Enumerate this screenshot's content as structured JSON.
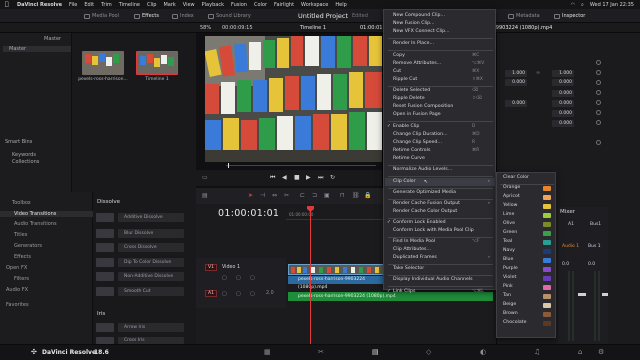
{
  "menubar": {
    "apple": "",
    "items": [
      "DaVinci Resolve",
      "File",
      "Edit",
      "Trim",
      "Timeline",
      "Clip",
      "Mark",
      "View",
      "Playback",
      "Fusion",
      "Color",
      "Fairlight",
      "Workspace",
      "Help"
    ],
    "datetime": "Wed 17 Jan  22:35"
  },
  "toolbar": {
    "media_pool": "Media Pool",
    "effects": "Effects",
    "index": "Index",
    "sound_library": "Sound Library",
    "project_title": "Untitled Project",
    "project_status": "Edited",
    "metadata": "Metadata",
    "inspector": "Inspector"
  },
  "viewer": {
    "zoom": "58%",
    "timecode": "00:00:09:15",
    "timeline_name": "Timeline 1",
    "timecode_right": "01:00:01"
  },
  "media_pool": {
    "bin_master": "Master",
    "header": "Master",
    "smart_bins": "Smart Bins",
    "smart_items": [
      "Keywords",
      "Collections"
    ],
    "clips": [
      {
        "name": "pexels-ross-harrison..."
      },
      {
        "name": "Timeline 1"
      }
    ]
  },
  "effects": {
    "toolbox": "Toolbox",
    "categories": [
      "Video Transitions",
      "Audio Transitions",
      "Titles",
      "Generators",
      "Effects"
    ],
    "open_fx": "Open FX",
    "filters": "Filters",
    "audio_fx": "Audio FX",
    "favorites": "Favorites",
    "section_dissolve": "Dissolve",
    "dissolves": [
      "Additive Dissolve",
      "Blur Dissolve",
      "Cross Dissolve",
      "Dip To Color Dissolve",
      "Non-Additive Dissolve",
      "Smooth Cut"
    ],
    "section_iris": "Iris",
    "iris": [
      "Arrow Iris",
      "Cross Iris"
    ]
  },
  "timeline": {
    "timecode": "01:00:01:01",
    "ruler_start": "01:00:00:00",
    "video_track_badge": "V1",
    "video_track_name": "Video 1",
    "audio_track_badge": "A1",
    "audio_value": "2.0",
    "video_clip_name": "pexels-ross-harrison-9903224 (1080p).mp4",
    "audio_clip_name": "pexels-ross-harrison-9903224 (1080p).mp4",
    "video_clip_count": "1 Clip"
  },
  "inspector": {
    "filename": "-9903224 (1080p).mp4",
    "zoom_x": "1.000",
    "zoom_y": "1.000",
    "pos_x": "0.000",
    "pos_y": "0.000",
    "rot": "0.000",
    "anchor_x": "0.000",
    "anchor_y": "0.000",
    "pitch": "0.000",
    "yaw": "0.000"
  },
  "mixer": {
    "title": "Mixer",
    "a1": "A1",
    "bus1": "Bus1",
    "audio1": "Audio 1",
    "bus1b": "Bus 1",
    "val1": "0.0",
    "val2": "0.0"
  },
  "context_menu": {
    "items": [
      {
        "label": "New Compound Clip...",
        "shortcut": ""
      },
      {
        "label": "New Fusion Clip...",
        "shortcut": ""
      },
      {
        "label": "New VFX Connect Clip...",
        "shortcut": ""
      },
      {
        "label": "Render In Place...",
        "shortcut": ""
      },
      {
        "label": "Copy",
        "shortcut": "⌘C"
      },
      {
        "label": "Remove Attributes...",
        "shortcut": "⌥⌘V"
      },
      {
        "label": "Cut",
        "shortcut": "⌘X"
      },
      {
        "label": "Ripple Cut",
        "shortcut": "⇧⌘X"
      },
      {
        "label": "Delete Selected",
        "shortcut": "⌫"
      },
      {
        "label": "Ripple Delete",
        "shortcut": "⇧⌫"
      },
      {
        "label": "Reset Fusion Composition",
        "shortcut": ""
      },
      {
        "label": "Open in Fusion Page",
        "shortcut": ""
      },
      {
        "label": "Enable Clip",
        "shortcut": "D"
      },
      {
        "label": "Change Clip Duration...",
        "shortcut": "⌘D"
      },
      {
        "label": "Change Clip Speed...",
        "shortcut": "R"
      },
      {
        "label": "Retime Controls",
        "shortcut": "⌘R"
      },
      {
        "label": "Retime Curve",
        "shortcut": ""
      },
      {
        "label": "Normalize Audio Levels...",
        "shortcut": ""
      },
      {
        "label": "Clip Color",
        "shortcut": ""
      },
      {
        "label": "Generate Optimized Media",
        "shortcut": ""
      },
      {
        "label": "Render Cache Fusion Output",
        "shortcut": ""
      },
      {
        "label": "Render Cache Color Output",
        "shortcut": ""
      },
      {
        "label": "Conform Lock Enabled",
        "shortcut": ""
      },
      {
        "label": "Conform Lock with Media Pool Clip",
        "shortcut": ""
      },
      {
        "label": "Find In Media Pool",
        "shortcut": "⌥F"
      },
      {
        "label": "Clip Attributes...",
        "shortcut": ""
      },
      {
        "label": "Duplicated Frames",
        "shortcut": ""
      },
      {
        "label": "Take Selector",
        "shortcut": ""
      },
      {
        "label": "Display Individual Audio Channels",
        "shortcut": ""
      },
      {
        "label": "Link Clips",
        "shortcut": "⌥⌘L"
      }
    ]
  },
  "color_submenu": {
    "items": [
      "Clear Color",
      "Orange",
      "Apricot",
      "Yellow",
      "Lime",
      "Olive",
      "Green",
      "Teal",
      "Navy",
      "Blue",
      "Purple",
      "Violet",
      "Pink",
      "Tan",
      "Beige",
      "Brown",
      "Chocolate"
    ],
    "swatches": [
      "",
      "#e8842b",
      "#f0a35a",
      "#e6c43a",
      "#9ccc3b",
      "#7c8a2a",
      "#3aa04a",
      "#2a9d95",
      "#1c3b7a",
      "#3a7ad8",
      "#8a4ad0",
      "#6a3ab8",
      "#e06aa8",
      "#b8906a",
      "#d8c8a8",
      "#8a5a3a",
      "#5a3a22"
    ]
  },
  "bottom": {
    "brand": "DaVinci Resolve",
    "version": "18.6"
  }
}
